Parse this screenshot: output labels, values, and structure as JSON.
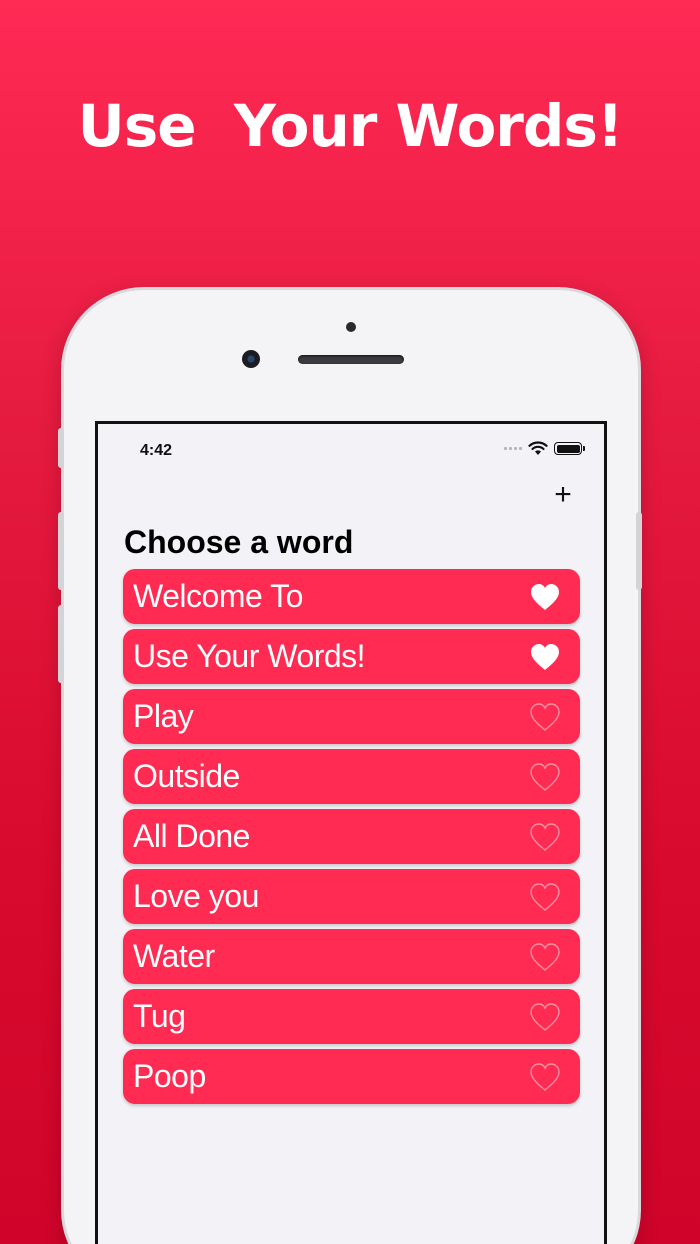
{
  "headline": "Use  Your Words!",
  "status_bar": {
    "time": "4:42"
  },
  "screen_title": "Choose a word",
  "add_button_glyph": "+",
  "colors": {
    "accent": "#ff2b52",
    "background": "#f2f2f7"
  },
  "words": [
    {
      "label": "Welcome To",
      "favorite": true,
      "icon": "heart-filled-icon"
    },
    {
      "label": "Use Your Words!",
      "favorite": true,
      "icon": "heart-filled-icon"
    },
    {
      "label": "Play",
      "favorite": false,
      "icon": "heart-outline-icon"
    },
    {
      "label": "Outside",
      "favorite": false,
      "icon": "heart-outline-icon"
    },
    {
      "label": "All Done",
      "favorite": false,
      "icon": "heart-outline-icon"
    },
    {
      "label": "Love you",
      "favorite": false,
      "icon": "heart-outline-icon"
    },
    {
      "label": "Water",
      "favorite": false,
      "icon": "heart-outline-icon"
    },
    {
      "label": "Tug",
      "favorite": false,
      "icon": "heart-outline-icon"
    },
    {
      "label": "Poop",
      "favorite": false,
      "icon": "heart-outline-icon"
    }
  ]
}
